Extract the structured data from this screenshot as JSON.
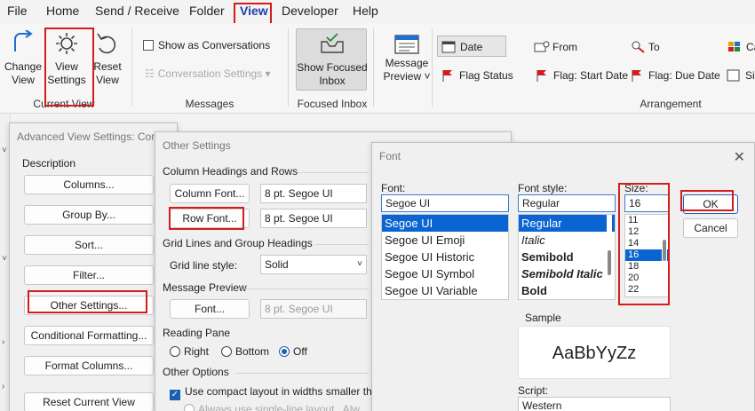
{
  "menu": {
    "items": [
      "File",
      "Home",
      "Send / Receive",
      "Folder",
      "View",
      "Developer",
      "Help"
    ],
    "active": "View"
  },
  "ribbon": {
    "change_view": [
      "Change",
      "View"
    ],
    "view_settings": [
      "View",
      "Settings"
    ],
    "reset_view": [
      "Reset",
      "View"
    ],
    "current_view_label": "Current View",
    "show_as_conversations": "Show as Conversations",
    "conversation_settings": "Conversation Settings",
    "messages_label": "Messages",
    "show_focused_inbox": [
      "Show Focused",
      "Inbox"
    ],
    "focused_inbox_label": "Focused Inbox",
    "message_preview": [
      "Message",
      "Preview"
    ],
    "arrangement": {
      "date": "Date",
      "from": "From",
      "to": "To",
      "ca": "Ca",
      "flag_status": "Flag Status",
      "flag_start_date": "Flag: Start Date",
      "flag_due_date": "Flag: Due Date",
      "size": "Siz",
      "label": "Arrangement"
    }
  },
  "advanced_view": {
    "title": "Advanced View Settings: Com",
    "description_label": "Description",
    "buttons": {
      "columns": "Columns...",
      "group_by": "Group By...",
      "sort": "Sort...",
      "filter": "Filter...",
      "other_settings": "Other Settings...",
      "conditional_formatting": "Conditional Formatting...",
      "format_columns": "Format Columns...",
      "reset_current_view": "Reset Current View"
    }
  },
  "other_settings": {
    "title": "Other Settings",
    "column_headings_label": "Column Headings and Rows",
    "column_font_button": "Column Font...",
    "column_font_value": "8 pt. Segoe UI",
    "row_font_button": "Row Font...",
    "row_font_value": "8 pt. Segoe UI",
    "grid_lines_label": "Grid Lines and Group Headings",
    "grid_line_style_label": "Grid line style:",
    "grid_line_style_value": "Solid",
    "message_preview_label": "Message Preview",
    "preview_font_button": "Font...",
    "preview_font_value": "8 pt. Segoe UI",
    "reading_pane_label": "Reading Pane",
    "reading_pane_options": [
      "Right",
      "Bottom",
      "Off"
    ],
    "reading_pane_selected": "Off",
    "other_options_label": "Other Options",
    "compact_layout": "Use compact layout in widths smaller tha",
    "single_line_layout": "Always use single-line layout",
    "cut_text": "Alw"
  },
  "font_dialog": {
    "title": "Font",
    "font_label": "Font:",
    "font_value": "Segoe UI",
    "fonts": [
      "Segoe UI",
      "Segoe UI Emoji",
      "Segoe UI Historic",
      "Segoe UI Symbol",
      "Segoe UI Variable"
    ],
    "font_selected": "Segoe UI",
    "style_label": "Font style:",
    "style_value": "Regular",
    "styles": [
      "Regular",
      "Italic",
      "Semibold",
      "Semibold Italic",
      "Bold"
    ],
    "style_selected": "Regular",
    "size_label": "Size:",
    "size_value": "16",
    "sizes": [
      "11",
      "12",
      "14",
      "16",
      "18",
      "20",
      "22"
    ],
    "size_selected": "16",
    "ok": "OK",
    "cancel": "Cancel",
    "sample_label": "Sample",
    "sample_text": "AaBbYyZz",
    "script_label": "Script:",
    "script_value": "Western"
  },
  "colors": {
    "highlight_red": "#d41c1c",
    "selection_blue": "#0a64d2",
    "accent_blue": "#1a5fb4"
  }
}
